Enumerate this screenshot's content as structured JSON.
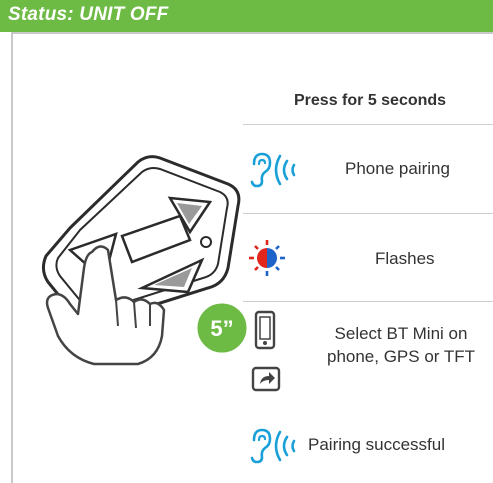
{
  "status": {
    "label": "Status: UNIT OFF"
  },
  "instruction": {
    "header": "Press for 5 seconds"
  },
  "timer_badge": {
    "label": "5”"
  },
  "steps": [
    {
      "icon": "ear-sound-icon",
      "text": "Phone pairing"
    },
    {
      "icon": "led-flash-red-blue-icon",
      "text": "Flashes"
    },
    {
      "icon": "phone-share-icon",
      "text_line1": "Select BT Mini on",
      "text_line2": "phone, GPS or TFT"
    },
    {
      "icon": "ear-sound-icon",
      "text": "Pairing successful"
    }
  ],
  "colors": {
    "status_bar": "#6dbb45",
    "badge": "#6dbb45",
    "sound_icon": "#1aa0d8",
    "led_red": "#e1251b",
    "led_blue": "#1e64c8"
  }
}
